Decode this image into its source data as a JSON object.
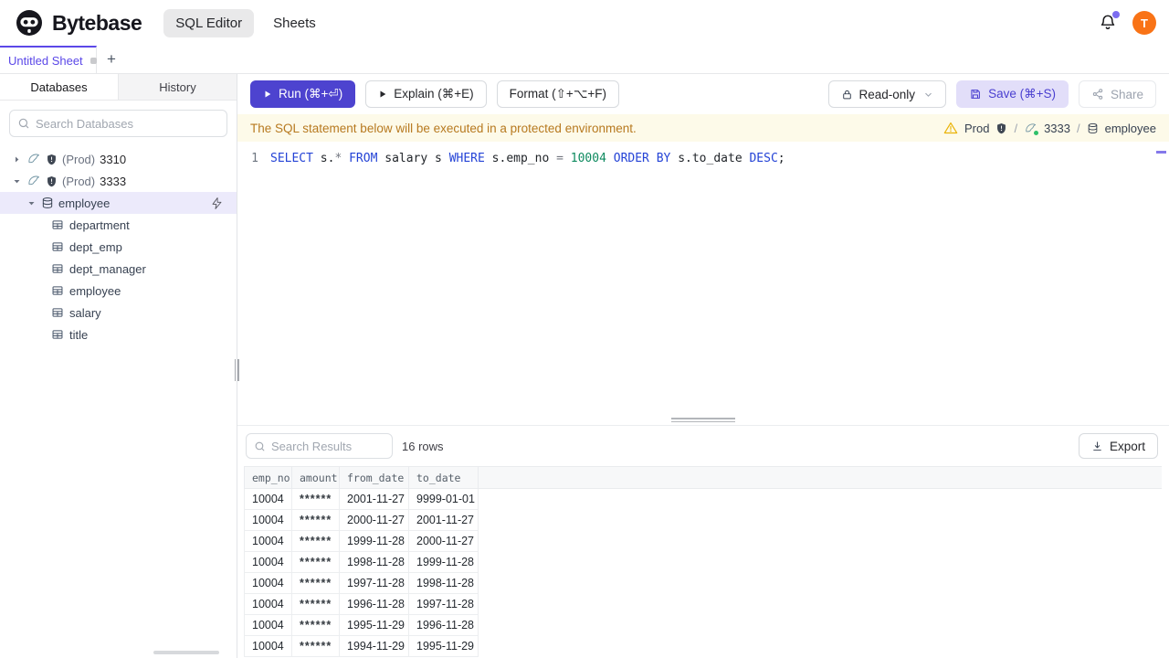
{
  "header": {
    "brand": "Bytebase",
    "nav": [
      {
        "label": "SQL Editor",
        "active": true
      },
      {
        "label": "Sheets",
        "active": false
      }
    ],
    "avatar_initial": "T"
  },
  "sheet_tabs": {
    "active_tab": "Untitled Sheet",
    "new_tab_label": "+"
  },
  "sidebar": {
    "tabs": [
      {
        "label": "Databases",
        "active": true
      },
      {
        "label": "History",
        "active": false
      }
    ],
    "search_placeholder": "Search Databases",
    "servers": [
      {
        "env": "(Prod)",
        "name": "3310",
        "expanded": false
      },
      {
        "env": "(Prod)",
        "name": "3333",
        "expanded": true
      }
    ],
    "database": {
      "label": "employee",
      "selected": true
    },
    "tables": [
      "department",
      "dept_emp",
      "dept_manager",
      "employee",
      "salary",
      "title"
    ]
  },
  "toolbar": {
    "run_label": "Run (⌘+⏎)",
    "explain_label": "Explain (⌘+E)",
    "format_label": "Format (⇧+⌥+F)",
    "readonly_label": "Read-only",
    "save_label": "Save (⌘+S)",
    "share_label": "Share"
  },
  "banner": {
    "message": "The SQL statement below will be executed in a protected environment.",
    "environment": "Prod",
    "separator1": "/",
    "instance": "3333",
    "separator2": "/",
    "database": "employee"
  },
  "editor": {
    "line_number": "1",
    "sql_text": "SELECT s.* FROM salary s WHERE s.emp_no = 10004 ORDER BY s.to_date DESC;",
    "sql_tokens": [
      {
        "text": "SELECT",
        "type": "keyword"
      },
      {
        "text": " s.",
        "type": "plain"
      },
      {
        "text": "*",
        "type": "operator"
      },
      {
        "text": " ",
        "type": "plain"
      },
      {
        "text": "FROM",
        "type": "keyword"
      },
      {
        "text": " salary s ",
        "type": "plain"
      },
      {
        "text": "WHERE",
        "type": "keyword"
      },
      {
        "text": " s.emp_no ",
        "type": "plain"
      },
      {
        "text": "=",
        "type": "operator"
      },
      {
        "text": " ",
        "type": "plain"
      },
      {
        "text": "10004",
        "type": "number"
      },
      {
        "text": " ",
        "type": "plain"
      },
      {
        "text": "ORDER BY",
        "type": "keyword"
      },
      {
        "text": " s.to_date ",
        "type": "plain"
      },
      {
        "text": "DESC",
        "type": "keyword"
      },
      {
        "text": ";",
        "type": "plain"
      }
    ]
  },
  "results": {
    "search_placeholder": "Search Results",
    "row_count": "16 rows",
    "export_label": "Export",
    "columns": [
      "emp_no",
      "amount",
      "from_date",
      "to_date"
    ],
    "rows": [
      [
        "10004",
        "******",
        "2001-11-27",
        "9999-01-01"
      ],
      [
        "10004",
        "******",
        "2000-11-27",
        "2001-11-27"
      ],
      [
        "10004",
        "******",
        "1999-11-28",
        "2000-11-27"
      ],
      [
        "10004",
        "******",
        "1998-11-28",
        "1999-11-28"
      ],
      [
        "10004",
        "******",
        "1997-11-28",
        "1998-11-28"
      ],
      [
        "10004",
        "******",
        "1996-11-28",
        "1997-11-28"
      ],
      [
        "10004",
        "******",
        "1995-11-29",
        "1996-11-28"
      ],
      [
        "10004",
        "******",
        "1994-11-29",
        "1995-11-29"
      ]
    ]
  },
  "colors": {
    "accent_indigo": "#4d43cf",
    "active_tab_purple": "#5b48e8",
    "avatar_orange": "#f97316",
    "warning_bg": "#fdfae9",
    "warning_text": "#b7791f",
    "selected_row_bg": "#eceafb",
    "syntax_keyword": "#2443d6",
    "syntax_number": "#0e8a5f",
    "status_green": "#2fc06a",
    "notification_purple": "#7c6cf0"
  }
}
